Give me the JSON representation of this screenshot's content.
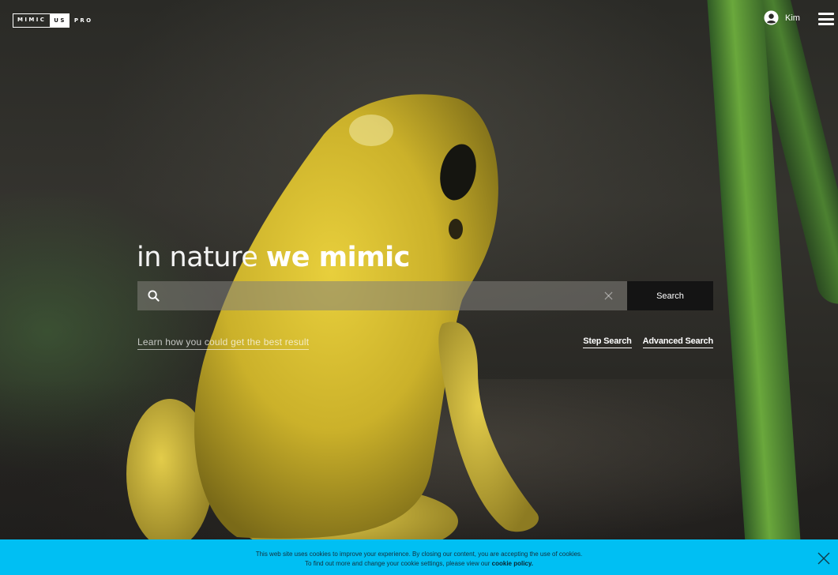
{
  "header": {
    "logo": {
      "part1": "MIMIC",
      "part2": "US",
      "part3": "PRO"
    },
    "user": {
      "name": "Kim",
      "icon": "user-circle-icon"
    },
    "menu_icon": "hamburger-menu-icon"
  },
  "hero": {
    "title_light": "in nature",
    "title_bold": "we mimic"
  },
  "search": {
    "value": "",
    "placeholder": "",
    "button_label": "Search",
    "search_icon": "search-icon",
    "clear_icon": "close-icon"
  },
  "hints": {
    "learn_link": "Learn how you could get the best result",
    "step_search": "Step Search",
    "advanced_search": "Advanced Search"
  },
  "cookie": {
    "line1": "This web site uses cookies to improve your experience. By closing our content, you are accepting the use of cookies.",
    "line2_prefix": "To find out more and change your cookie settings, please view our ",
    "policy_link": "cookie policy.",
    "close_icon": "close-icon",
    "background_color": "#00bff3"
  }
}
